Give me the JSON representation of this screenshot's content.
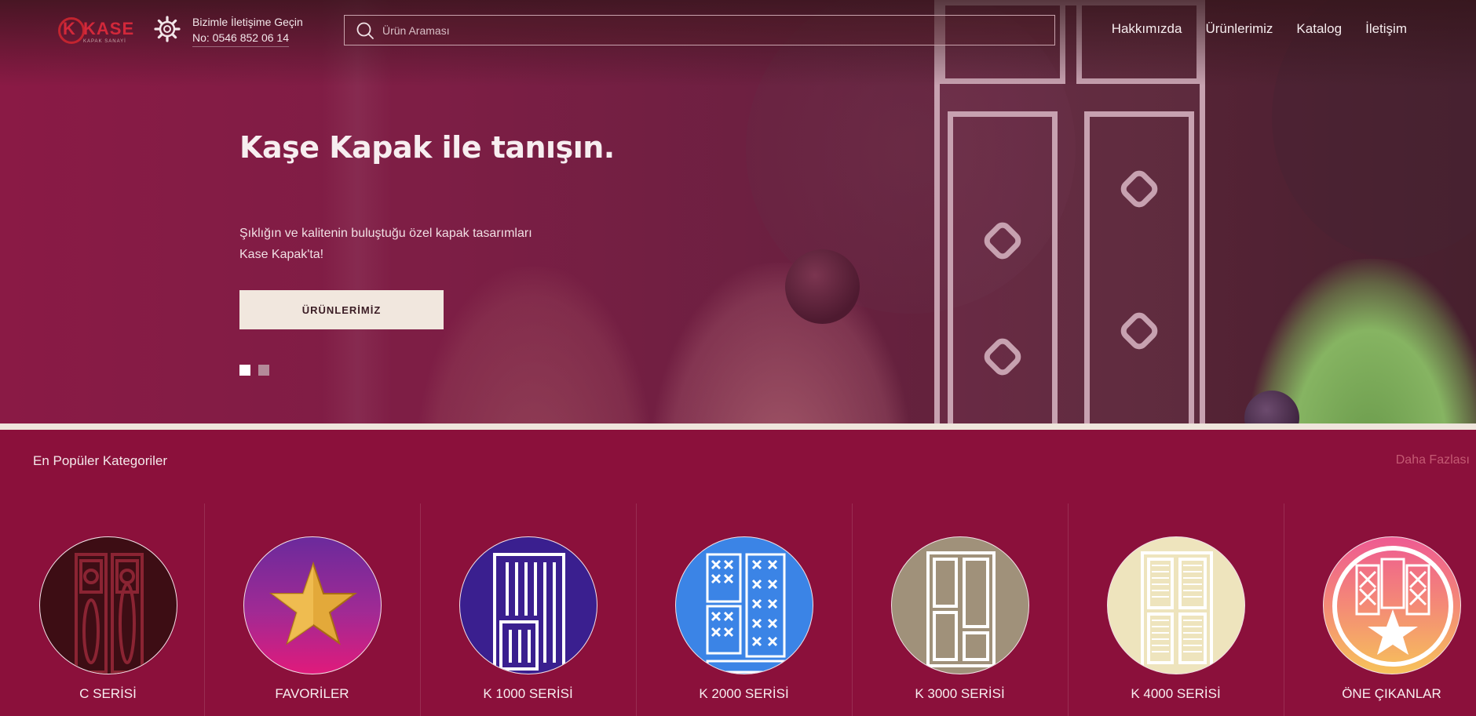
{
  "header": {
    "logo_text": "KASE",
    "logo_subtitle": "KAPAK SANAYİ",
    "contact_line1": "Bizimle İletişime Geçin",
    "contact_line2": "No: 0546 852 06 14",
    "search_placeholder": "Ürün Araması",
    "nav": [
      "Hakkımızda",
      "Ürünlerimiz",
      "Katalog",
      "İletişim"
    ]
  },
  "hero": {
    "title": "Kaşe Kapak ile tanışın.",
    "subtitle_line1": "Şıklığın ve kalitenin buluştuğu özel kapak tasarımları",
    "subtitle_line2": "Kase Kapak'ta!",
    "cta_label": "ÜRÜNLERİMİZ",
    "slide_count": 2,
    "active_slide": 1
  },
  "categories": {
    "title": "En Popüler Kategoriler",
    "more_label": "Daha Fazlası",
    "items": [
      {
        "label": "C SERİSİ",
        "icon": "ornate-door-icon",
        "color": "#3d0d14"
      },
      {
        "label": "FAVORİLER",
        "icon": "star-icon",
        "color": "#b4268d"
      },
      {
        "label": "K 1000 SERİSİ",
        "icon": "striped-door-icon",
        "color": "#3a1f8f"
      },
      {
        "label": "K 2000 SERİSİ",
        "icon": "cross-pattern-door-icon",
        "color": "#3b84e6"
      },
      {
        "label": "K 3000 SERİSİ",
        "icon": "panel-door-icon",
        "color": "#a0917a"
      },
      {
        "label": "K 4000 SERİSİ",
        "icon": "louver-door-icon",
        "color": "#eee4bd"
      },
      {
        "label": "ÖNE ÇIKANLAR",
        "icon": "featured-star-icon",
        "color": "#f5a35c"
      }
    ]
  }
}
